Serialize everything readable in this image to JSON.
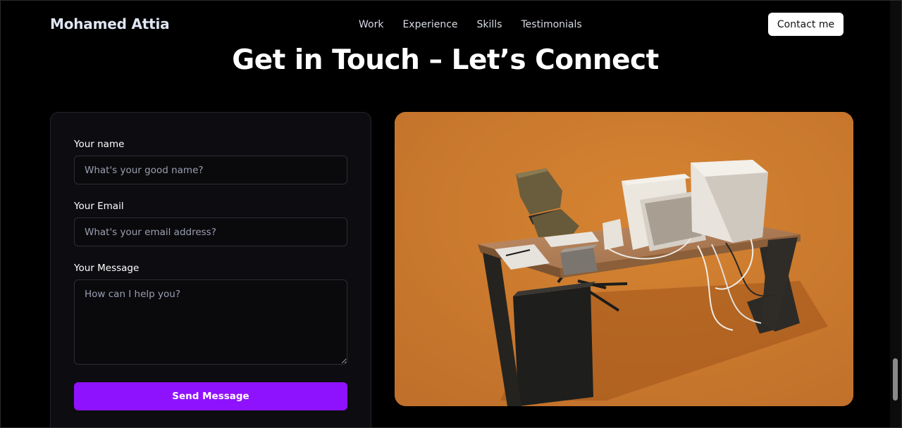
{
  "navbar": {
    "brand": "Mohamed Attia",
    "links": [
      "Work",
      "Experience",
      "Skills",
      "Testimonials"
    ],
    "contact_label": "Contact me"
  },
  "page": {
    "title": "Get in Touch – Let’s Connect"
  },
  "form": {
    "name_label": "Your name",
    "name_placeholder": "What's your good name?",
    "email_label": "Your Email",
    "email_placeholder": "What's your email address?",
    "message_label": "Your Message",
    "message_placeholder": "How can I help you?",
    "submit_label": "Send Message"
  },
  "colors": {
    "accent": "#8f12fe",
    "scene_background": "#cd7a30",
    "card_background": "#0d0d11"
  },
  "scene": {
    "icon": "desk-workstation-3d-illustration"
  }
}
